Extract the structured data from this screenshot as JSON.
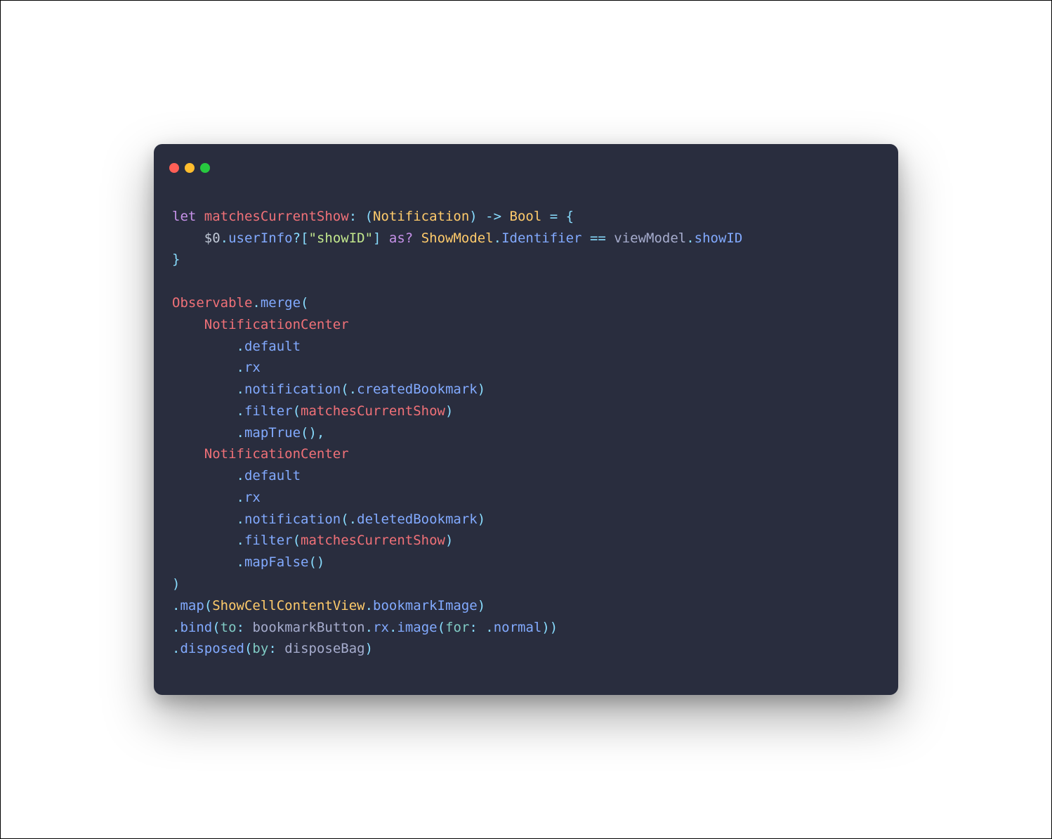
{
  "window": {
    "traffic": {
      "red": "#ff5f56",
      "yellow": "#ffbd2e",
      "green": "#27c93f"
    }
  },
  "code": {
    "l1_let": "let",
    "l1_name": "matchesCurrentShow",
    "l1_colon_open": ": (",
    "l1_notif": "Notification",
    "l1_close_arrow": ") -> ",
    "l1_bool": "Bool",
    "l1_eq_brace": " = {",
    "l2_indent": "    ",
    "l2_dollar": "$0",
    "l2_dot1": ".",
    "l2_userInfo": "userInfo",
    "l2_opt_qs": "?[",
    "l2_str": "\"showID\"",
    "l2_close_br": "] ",
    "l2_as": "as?",
    "l2_sp": " ",
    "l2_showmodel": "ShowModel",
    "l2_dot2": ".",
    "l2_ident": "Identifier",
    "l2_eqeq": " == ",
    "l2_viewmodel": "viewModel",
    "l2_dot3": ".",
    "l2_showid": "showID",
    "l3_brace": "}",
    "l5_observable": "Observable",
    "l5_dot": ".",
    "l5_merge": "merge",
    "l5_open": "(",
    "l6_indent": "    ",
    "l6_nc": "NotificationCenter",
    "l7_indent": "        .",
    "l7_default": "default",
    "l8_indent": "        .",
    "l8_rx": "rx",
    "l9_indent": "        .",
    "l9_notification": "notification",
    "l9_open": "(.",
    "l9_created": "createdBookmark",
    "l9_close": ")",
    "l10_indent": "        .",
    "l10_filter": "filter",
    "l10_open": "(",
    "l10_arg": "matchesCurrentShow",
    "l10_close": ")",
    "l11_indent": "        .",
    "l11_maptrue": "mapTrue",
    "l11_parens": "(),",
    "l12_indent": "    ",
    "l12_nc": "NotificationCenter",
    "l13_indent": "        .",
    "l13_default": "default",
    "l14_indent": "        .",
    "l14_rx": "rx",
    "l15_indent": "        .",
    "l15_notification": "notification",
    "l15_open": "(.",
    "l15_deleted": "deletedBookmark",
    "l15_close": ")",
    "l16_indent": "        .",
    "l16_filter": "filter",
    "l16_open": "(",
    "l16_arg": "matchesCurrentShow",
    "l16_close": ")",
    "l17_indent": "        .",
    "l17_mapfalse": "mapFalse",
    "l17_parens": "()",
    "l18_close": ")",
    "l19_dot": ".",
    "l19_map": "map",
    "l19_open": "(",
    "l19_type": "ShowCellContentView",
    "l19_dot2": ".",
    "l19_prop": "bookmarkImage",
    "l19_close": ")",
    "l20_dot": ".",
    "l20_bind": "bind",
    "l20_open": "(",
    "l20_to": "to",
    "l20_colon": ": ",
    "l20_btn": "bookmarkButton",
    "l20_dot2": ".",
    "l20_rx": "rx",
    "l20_dot3": ".",
    "l20_image": "image",
    "l20_open2": "(",
    "l20_for": "for",
    "l20_colon2": ": .",
    "l20_normal": "normal",
    "l20_close": "))",
    "l21_dot": ".",
    "l21_disposed": "disposed",
    "l21_open": "(",
    "l21_by": "by",
    "l21_colon": ": ",
    "l21_bag": "disposeBag",
    "l21_close": ")"
  }
}
